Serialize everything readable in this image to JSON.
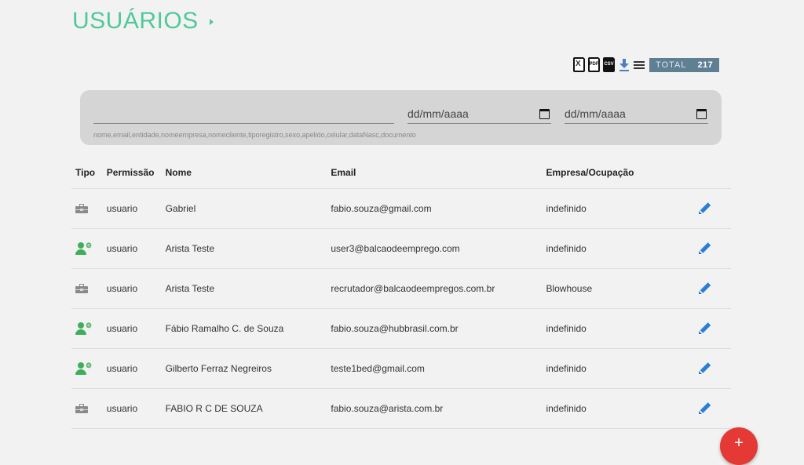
{
  "page": {
    "title": "USUÁRIOS"
  },
  "toolbar": {
    "excel_icon": "excel-file-icon",
    "pdf_label": "PDF",
    "csv_label": "CSV",
    "total_label": "TOTAL",
    "total_value": "217"
  },
  "filter": {
    "search_value": "",
    "search_hint": "nome,email,entidade,nomeempresa,nomecliente,tiporegistro,sexo,apelido,celular,dataNasc,documento",
    "date_from_placeholder": "dd/mm/aaaa",
    "date_to_placeholder": "dd/mm/aaaa"
  },
  "table": {
    "headers": {
      "tipo": "Tipo",
      "permissao": "Permissão",
      "nome": "Nome",
      "email": "Email",
      "empresa": "Empresa/Ocupação"
    },
    "rows": [
      {
        "tipo_icon": "briefcase-icon",
        "permissao": "usuario",
        "nome": "Gabriel",
        "email": "fabio.souza@gmail.com",
        "empresa": "indefinido"
      },
      {
        "tipo_icon": "person-icon",
        "permissao": "usuario",
        "nome": "Arista Teste",
        "email": "user3@balcaodeemprego.com",
        "empresa": "indefinido"
      },
      {
        "tipo_icon": "briefcase-icon",
        "permissao": "usuario",
        "nome": "Arista Teste",
        "email": "recrutador@balcaodeempregos.com.br",
        "empresa": "Blowhouse"
      },
      {
        "tipo_icon": "person-icon",
        "permissao": "usuario",
        "nome": "Fábio Ramalho C. de Souza",
        "email": "fabio.souza@hubbrasil.com.br",
        "empresa": "indefinido"
      },
      {
        "tipo_icon": "person-icon",
        "permissao": "usuario",
        "nome": "Gilberto Ferraz Negreiros",
        "email": "teste1bed@gmail.com",
        "empresa": "indefinido"
      },
      {
        "tipo_icon": "briefcase-icon",
        "permissao": "usuario",
        "nome": "FABIO R C DE SOUZA",
        "email": "fabio.souza@arista.com.br",
        "empresa": "indefinido"
      }
    ]
  },
  "fab": {
    "label": "+"
  },
  "colors": {
    "accent": "#4fc99a",
    "edit": "#2a7fd4",
    "person": "#3fae5a",
    "fab": "#e53935",
    "total_bg": "#5f7f93"
  }
}
